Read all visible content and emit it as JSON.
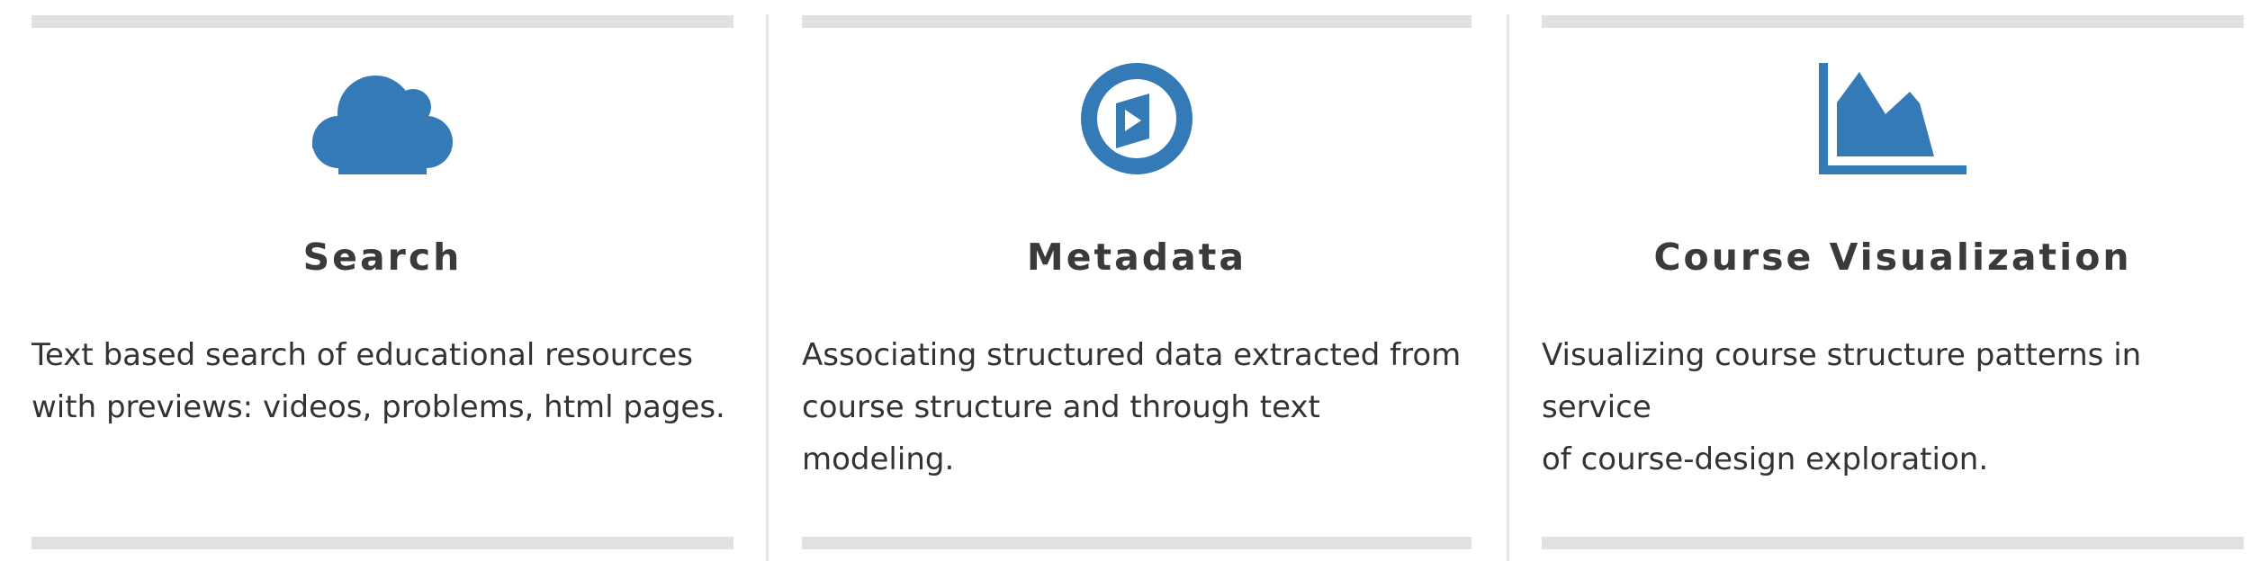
{
  "accent_color": "#337ab7",
  "features": [
    {
      "icon": "cloud-icon",
      "title": "Search",
      "description_line1": "Text based search of educational resources",
      "description_line2": "with previews: videos, problems, html pages."
    },
    {
      "icon": "play-circle-icon",
      "title": "Metadata",
      "description_line1": "Associating structured data extracted from",
      "description_line2": "course structure and through text modeling."
    },
    {
      "icon": "area-chart-icon",
      "title": "Course Visualization",
      "description_line1": "Visualizing course structure patterns in service",
      "description_line2": "of course-design exploration."
    }
  ]
}
